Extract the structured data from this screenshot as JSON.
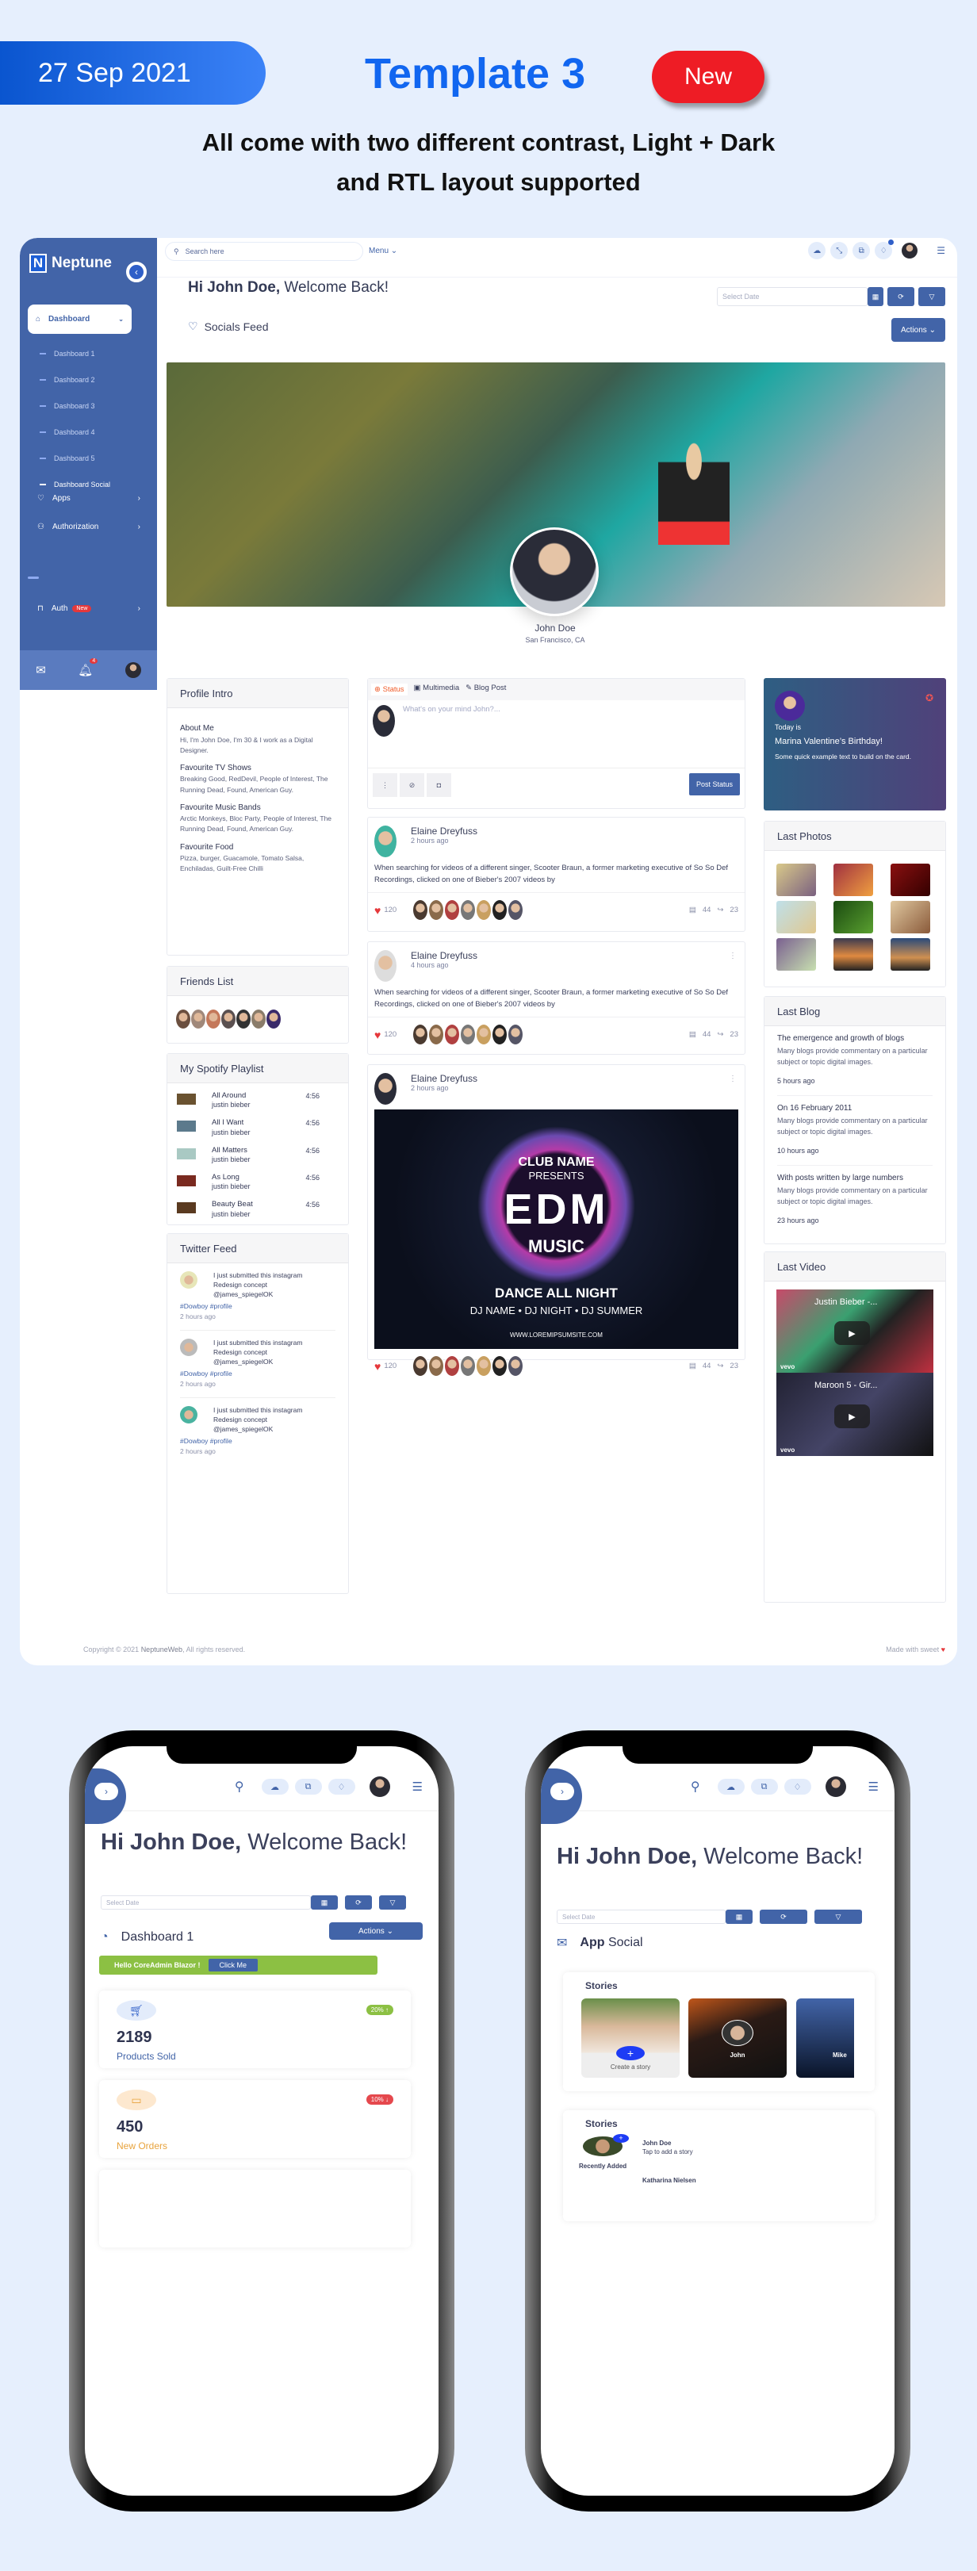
{
  "banner": {
    "date": "27 Sep 2021",
    "title": "Template 3",
    "badge": "New",
    "subtitle_line1": "All come with two different contrast, Light + Dark",
    "subtitle_line2": "and RTL layout supported",
    "accent": "#1166f0",
    "badge_color": "#ee1c25"
  },
  "sidebar": {
    "brand": "Neptune",
    "logo_letter": "N",
    "active": {
      "label": "Dashboard",
      "icon": "home-icon"
    },
    "sub_items": [
      "Dashboard 1",
      "Dashboard 2",
      "Dashboard 3",
      "Dashboard 4",
      "Dashboard 5",
      "Dashboard Social"
    ],
    "items": [
      {
        "label": "Apps",
        "icon": "lightbulb-icon"
      },
      {
        "label": "Authorization",
        "icon": "users-icon"
      }
    ],
    "auth": {
      "label": "Auth",
      "badge": "New"
    },
    "notification_count": "4",
    "color": "#4264a8"
  },
  "topbar": {
    "search_placeholder": "Search here",
    "menu_label": "Menu"
  },
  "header": {
    "greeting_bold": "Hi John Doe,",
    "greeting_rest": " Welcome Back!",
    "date_placeholder": "Select Date",
    "section_title": "Socials Feed",
    "actions_label": "Actions"
  },
  "profile": {
    "name": "John Doe",
    "location": "San Francisco, CA"
  },
  "profile_intro": {
    "title": "Profile Intro",
    "sections": [
      {
        "heading": "About Me",
        "text": "Hi, I'm John Doe, I'm 30 & I work as a Digital Designer."
      },
      {
        "heading": "Favourite TV Shows",
        "text": "Breaking Good, RedDevil, People of Interest, The Running Dead, Found, American Guy."
      },
      {
        "heading": "Favourite Music Bands",
        "text": "Arctic Monkeys, Bloc Party, People of Interest, The Running Dead, Found, American Guy."
      },
      {
        "heading": "Favourite Food",
        "text": "Pizza, burger, Guacamole, Tomato Salsa, Enchiladas, Guilt-Free Chilli"
      }
    ]
  },
  "friends": {
    "title": "Friends List"
  },
  "playlist": {
    "title": "My Spotify Playlist",
    "songs": [
      {
        "title": "All Around",
        "artist": "justin bieber",
        "duration": "4:56"
      },
      {
        "title": "All I Want",
        "artist": "justin bieber",
        "duration": "4:56"
      },
      {
        "title": "All Matters",
        "artist": "justin bieber",
        "duration": "4:56"
      },
      {
        "title": "As Long",
        "artist": "justin bieber",
        "duration": "4:56"
      },
      {
        "title": "Beauty Beat",
        "artist": "justin bieber",
        "duration": "4:56"
      }
    ]
  },
  "twitter": {
    "title": "Twitter Feed",
    "tweets": [
      {
        "text": "I just submitted this instagram Redesign concept @james_spiegelOK",
        "tags": "#Dowboy #profile",
        "time": "2 hours ago"
      },
      {
        "text": "I just submitted this instagram Redesign concept @james_spiegelOK",
        "tags": "#Dowboy #profile",
        "time": "2 hours ago"
      },
      {
        "text": "I just submitted this instagram Redesign concept @james_spiegelOK",
        "tags": "#Dowboy #profile",
        "time": "2 hours ago"
      }
    ]
  },
  "composer": {
    "tabs": [
      "Status",
      "Multimedia",
      "Blog Post"
    ],
    "placeholder": "What's on your mind John?...",
    "post_label": "Post Status"
  },
  "posts": [
    {
      "author": "Elaine Dreyfuss",
      "time": "2 hours ago",
      "text": "When searching for videos of a different singer, Scooter Braun, a former marketing executive of So So Def Recordings, clicked on one of Bieber's 2007 videos by",
      "likes": "120",
      "comments": "44",
      "shares": "23"
    },
    {
      "author": "Elaine Dreyfuss",
      "time": "4 hours ago",
      "text": "When searching for videos of a different singer, Scooter Braun, a former marketing executive of So So Def Recordings, clicked on one of Bieber's 2007 videos by",
      "likes": "120",
      "comments": "44",
      "shares": "23"
    },
    {
      "author": "Elaine Dreyfuss",
      "time": "2 hours ago",
      "likes": "120",
      "comments": "44",
      "shares": "23",
      "poster": {
        "club": "CLUB NAME",
        "presents": "PRESENTS",
        "logo": "EDM",
        "music": "MUSIC",
        "tagline": "DANCE ALL NIGHT",
        "djs": "DJ NAME  •  DJ NIGHT  •  DJ SUMMER",
        "url": "WWW.LOREMIPSUMSITE.COM"
      }
    }
  ],
  "birthday": {
    "label": "Today is",
    "title": "Marina Valentine’s Birthday!",
    "text": "Some quick example text to build on the card."
  },
  "photos": {
    "title": "Last Photos"
  },
  "blog": {
    "title": "Last Blog",
    "items": [
      {
        "title": "The emergence and growth of blogs",
        "text": "Many blogs provide commentary on a particular subject or topic digital images.",
        "time": "5 hours ago"
      },
      {
        "title": "On 16 February 2011",
        "text": "Many blogs provide commentary on a particular subject or topic digital images.",
        "time": "10 hours ago"
      },
      {
        "title": "With posts written by large numbers",
        "text": "Many blogs provide commentary on a particular subject or topic digital images.",
        "time": "23 hours ago"
      }
    ]
  },
  "videos": {
    "title": "Last Video",
    "items": [
      {
        "title": "Justin Bieber -...",
        "brand": "vevo"
      },
      {
        "title": "Maroon 5 - Gir...",
        "brand": "vevo"
      }
    ]
  },
  "footer": {
    "prefix": "Copyright © 2021 ",
    "brand": "NeptuneWeb",
    "suffix": ", All rights reserved.",
    "right": "Made with sweet"
  },
  "phone1": {
    "greeting_bold": "Hi John Doe,",
    "greeting_rest": " Welcome Back!",
    "date_placeholder": "Select Date",
    "section_title": "Dashboard 1",
    "actions_label": "Actions",
    "alert_text": "Hello CoreAdmin Blazor !",
    "alert_button": "Click Me",
    "stats": [
      {
        "value": "2189",
        "label": "Products Sold",
        "change": "20% ↑",
        "color": "#4264a8",
        "badge_color": "#8cc043"
      },
      {
        "value": "450",
        "label": "New Orders",
        "change": "10% ↓",
        "color": "#e8a33d",
        "badge_color": "#e5484d"
      }
    ]
  },
  "phone2": {
    "greeting_bold": "Hi John Doe,",
    "greeting_rest": " Welcome Back!",
    "date_placeholder": "Select Date",
    "section_bold": "App",
    "section_rest": " Social",
    "stories_title": "Stories",
    "create_story": "Create a story",
    "story_names": [
      "John",
      "Mike"
    ],
    "stories2_title": "Stories",
    "me_name": "John Doe",
    "me_sub": "Tap to add a story",
    "recently_added": "Recently Added",
    "recent_name": "Katharina Nielsen"
  }
}
